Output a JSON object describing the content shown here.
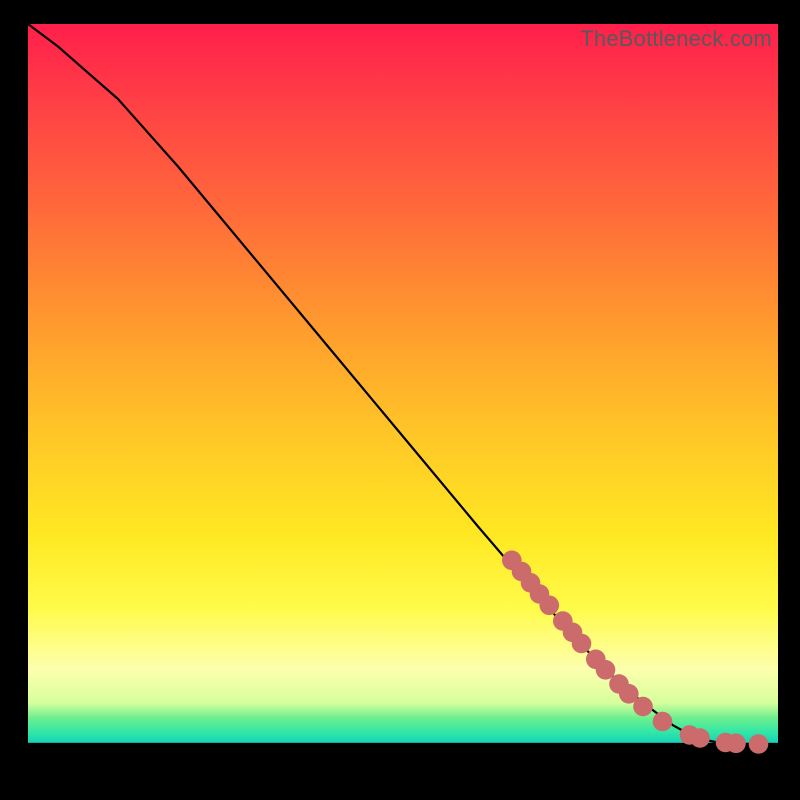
{
  "watermark": "TheBottleneck.com",
  "colors": {
    "marker": "#cb6b6b",
    "curve": "#000000"
  },
  "chart_data": {
    "type": "line",
    "title": "",
    "xlabel": "",
    "ylabel": "",
    "xlim": [
      0,
      100
    ],
    "ylim": [
      0,
      100
    ],
    "grid": false,
    "annotations": [],
    "_comment": "Axes are unlabeled in the image; values below are read in plot-area coordinates (0–100 both axes, origin bottom-left). Curve decreases from top-left, becomes nearly flat near the bottom-right.",
    "series": [
      {
        "name": "curve",
        "x": [
          0,
          4,
          8,
          12,
          20,
          30,
          40,
          50,
          60,
          66,
          70,
          74,
          78,
          82,
          86,
          88,
          90,
          92,
          94,
          96,
          98
        ],
        "y": [
          100,
          97,
          93.5,
          90,
          81,
          69,
          57,
          45,
          33,
          26,
          21.5,
          17,
          13,
          9.5,
          6.5,
          5.4,
          4.6,
          4.2,
          4.05,
          4.0,
          4.0
        ]
      }
    ],
    "markers": {
      "_comment": "Salmon marker clusters overlaid on the lower-right portion of the curve, approximate centers in the same 0–100 space.",
      "points": [
        {
          "x": 64.5,
          "y": 28.5
        },
        {
          "x": 65.8,
          "y": 27.0
        },
        {
          "x": 67.0,
          "y": 25.5
        },
        {
          "x": 68.2,
          "y": 24.0
        },
        {
          "x": 69.5,
          "y": 22.5
        },
        {
          "x": 71.3,
          "y": 20.4
        },
        {
          "x": 72.6,
          "y": 18.9
        },
        {
          "x": 73.8,
          "y": 17.4
        },
        {
          "x": 75.7,
          "y": 15.3
        },
        {
          "x": 77.0,
          "y": 13.9
        },
        {
          "x": 78.8,
          "y": 12.0
        },
        {
          "x": 80.1,
          "y": 10.7
        },
        {
          "x": 82.0,
          "y": 9.0
        },
        {
          "x": 84.6,
          "y": 7.0
        },
        {
          "x": 88.2,
          "y": 5.2
        },
        {
          "x": 89.6,
          "y": 4.8
        },
        {
          "x": 93.0,
          "y": 4.2
        },
        {
          "x": 94.4,
          "y": 4.1
        },
        {
          "x": 97.4,
          "y": 4.0
        }
      ],
      "radius": 1.3
    }
  }
}
